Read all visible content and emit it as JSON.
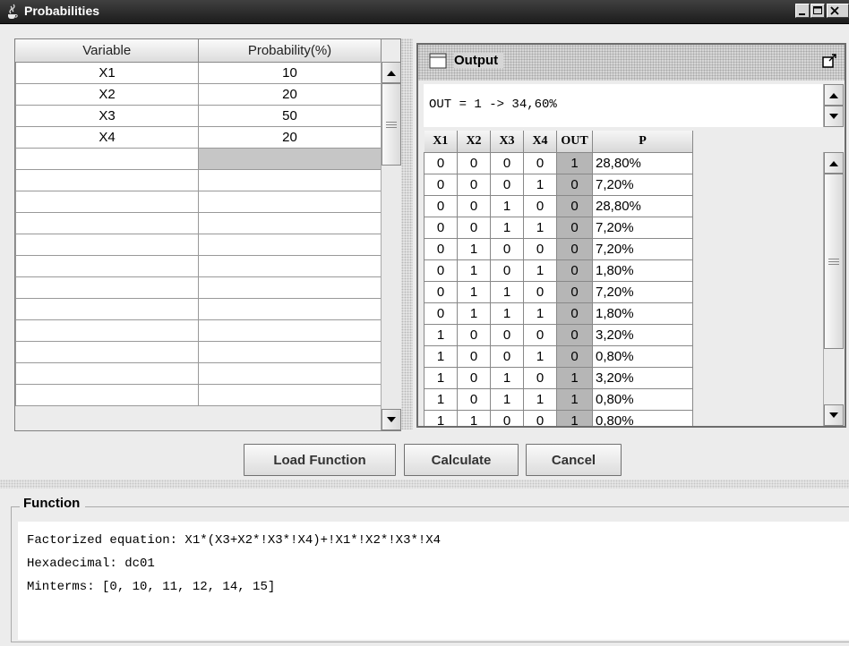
{
  "window": {
    "title": "Probabilities",
    "icon": "java-cup-icon",
    "controls": [
      "minimize",
      "maximize",
      "close"
    ]
  },
  "variables_table": {
    "headers": [
      "Variable",
      "Probability(%)"
    ],
    "rows": [
      [
        "X1",
        "10"
      ],
      [
        "X2",
        "20"
      ],
      [
        "X3",
        "50"
      ],
      [
        "X4",
        "20"
      ],
      [
        "",
        ""
      ],
      [
        "",
        ""
      ],
      [
        "",
        ""
      ],
      [
        "",
        ""
      ],
      [
        "",
        ""
      ],
      [
        "",
        ""
      ],
      [
        "",
        ""
      ],
      [
        "",
        ""
      ],
      [
        "",
        ""
      ],
      [
        "",
        ""
      ],
      [
        "",
        ""
      ],
      [
        "",
        ""
      ]
    ]
  },
  "output": {
    "title": "Output",
    "result_text": "OUT = 1 -> 34,60%",
    "headers": [
      "X1",
      "X2",
      "X3",
      "X4",
      "OUT",
      "P"
    ],
    "rows": [
      [
        "0",
        "0",
        "0",
        "0",
        "1",
        "28,80%"
      ],
      [
        "0",
        "0",
        "0",
        "1",
        "0",
        "7,20%"
      ],
      [
        "0",
        "0",
        "1",
        "0",
        "0",
        "28,80%"
      ],
      [
        "0",
        "0",
        "1",
        "1",
        "0",
        "7,20%"
      ],
      [
        "0",
        "1",
        "0",
        "0",
        "0",
        "7,20%"
      ],
      [
        "0",
        "1",
        "0",
        "1",
        "0",
        "1,80%"
      ],
      [
        "0",
        "1",
        "1",
        "0",
        "0",
        "7,20%"
      ],
      [
        "0",
        "1",
        "1",
        "1",
        "0",
        "1,80%"
      ],
      [
        "1",
        "0",
        "0",
        "0",
        "0",
        "3,20%"
      ],
      [
        "1",
        "0",
        "0",
        "1",
        "0",
        "0,80%"
      ],
      [
        "1",
        "0",
        "1",
        "0",
        "1",
        "3,20%"
      ],
      [
        "1",
        "0",
        "1",
        "1",
        "1",
        "0,80%"
      ],
      [
        "1",
        "1",
        "0",
        "0",
        "1",
        "0,80%"
      ]
    ]
  },
  "buttons": {
    "load": "Load Function",
    "calculate": "Calculate",
    "cancel": "Cancel"
  },
  "function_panel": {
    "legend": "Function",
    "lines": [
      "Factorized equation: X1*(X3+X2*!X3*!X4)+!X1*!X2*!X3*!X4",
      "Hexadecimal: dc01",
      "Minterms: [0, 10, 11, 12, 14, 15]"
    ]
  }
}
